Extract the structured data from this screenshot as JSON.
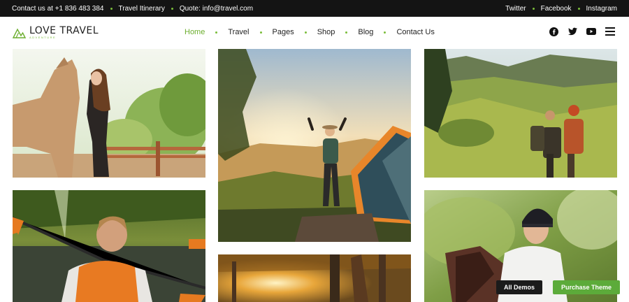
{
  "topbar": {
    "left": [
      "Contact us at +1 836 483 384",
      "Travel Itinerary",
      "Quote: info@travel.com"
    ],
    "right": [
      "Twitter",
      "Facebook",
      "Instagram"
    ]
  },
  "brand": {
    "name": "LOVE TRAVEL",
    "tagline": "ADVENTURE"
  },
  "menu": [
    "Home",
    "Travel",
    "Pages",
    "Shop",
    "Blog",
    "Contact Us"
  ],
  "menu_active": "Home",
  "header_icons": [
    "facebook-icon",
    "twitter-icon",
    "youtube-icon",
    "hamburger-menu-icon"
  ],
  "gallery": [
    {
      "name": "girl-with-horse-photo"
    },
    {
      "name": "hiker-with-tent-photo"
    },
    {
      "name": "hikers-in-valley-photo"
    },
    {
      "name": "kayaker-photo"
    },
    {
      "name": "autumn-forest-photo"
    },
    {
      "name": "girl-horse-riding-photo"
    }
  ],
  "buttons": {
    "all_demos": "All Demos",
    "purchase_theme": "Purchase Theme"
  },
  "colors": {
    "accent": "#7bbd3a",
    "topbar_bg": "#141414",
    "purchase_bg": "#5cab3a",
    "demos_bg": "#1b1b1b"
  }
}
